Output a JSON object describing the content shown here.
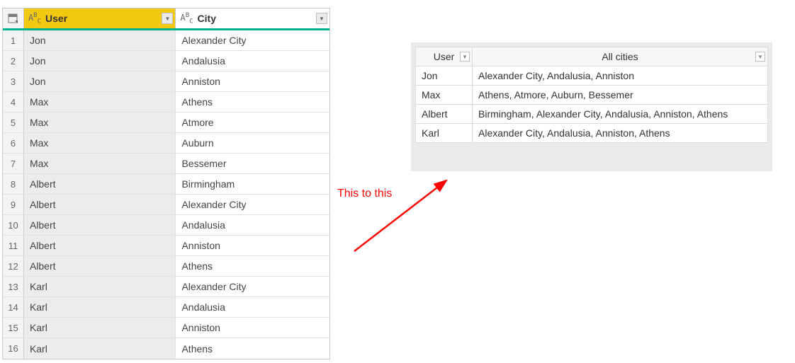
{
  "source_table": {
    "type_prefix_html": "A<sup>B</sup><sub>C</sub>",
    "columns": {
      "user": "User",
      "city": "City"
    },
    "rows": [
      {
        "n": "1",
        "user": "Jon",
        "city": "Alexander City"
      },
      {
        "n": "2",
        "user": "Jon",
        "city": "Andalusia"
      },
      {
        "n": "3",
        "user": "Jon",
        "city": "Anniston"
      },
      {
        "n": "4",
        "user": "Max",
        "city": "Athens"
      },
      {
        "n": "5",
        "user": "Max",
        "city": "Atmore"
      },
      {
        "n": "6",
        "user": "Max",
        "city": "Auburn"
      },
      {
        "n": "7",
        "user": "Max",
        "city": "Bessemer"
      },
      {
        "n": "8",
        "user": "Albert",
        "city": "Birmingham"
      },
      {
        "n": "9",
        "user": "Albert",
        "city": "Alexander City"
      },
      {
        "n": "10",
        "user": "Albert",
        "city": "Andalusia"
      },
      {
        "n": "11",
        "user": "Albert",
        "city": "Anniston"
      },
      {
        "n": "12",
        "user": "Albert",
        "city": "Athens"
      },
      {
        "n": "13",
        "user": "Karl",
        "city": "Alexander City"
      },
      {
        "n": "14",
        "user": "Karl",
        "city": "Andalusia"
      },
      {
        "n": "15",
        "user": "Karl",
        "city": "Anniston"
      },
      {
        "n": "16",
        "user": "Karl",
        "city": "Athens"
      }
    ]
  },
  "result_table": {
    "columns": {
      "user": "User",
      "all_cities": "All cities"
    },
    "rows": [
      {
        "user": "Jon",
        "cities": "Alexander City, Andalusia, Anniston"
      },
      {
        "user": "Max",
        "cities": "Athens, Atmore, Auburn, Bessemer"
      },
      {
        "user": "Albert",
        "cities": "Birmingham, Alexander City, Andalusia, Anniston, Athens"
      },
      {
        "user": "Karl",
        "cities": "Alexander City, Andalusia, Anniston, Athens"
      }
    ]
  },
  "annotation": {
    "text": "This to this",
    "color": "#ff0000"
  },
  "icons": {
    "dropdown": "▼"
  }
}
